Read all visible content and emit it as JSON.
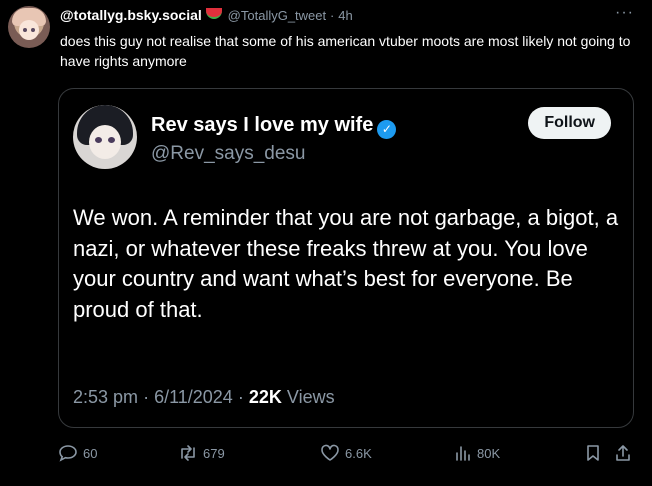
{
  "tweet": {
    "display_name": "@totallyg.bsky.social",
    "handle": "@TotallyG_tweet",
    "separator": "·",
    "time_ago": "4h",
    "more_label": "···",
    "text": "does this guy not realise that some of his american vtuber moots are most likely not going to have rights anymore"
  },
  "quoted": {
    "name": "Rev says I love my wife",
    "handle": "@Rev_says_desu",
    "follow_label": "Follow",
    "verified_glyph": "✓",
    "text": "We won. A reminder that you are not garbage, a bigot, a nazi, or whatever these freaks threw at you. You love your country and want what’s best for everyone. Be proud of that.",
    "time": "2:53 pm",
    "date_sep": "·",
    "date": "6/11/2024",
    "views_sep": "·",
    "views_count": "22K",
    "views_label": "Views"
  },
  "actions": {
    "replies": "60",
    "reposts": "679",
    "likes": "6.6K",
    "views": "80K"
  },
  "colors": {
    "background": "#000000",
    "text": "#e7e9ea",
    "muted": "#8b98a5",
    "verified": "#1d9bf0",
    "border": "#36393c"
  }
}
